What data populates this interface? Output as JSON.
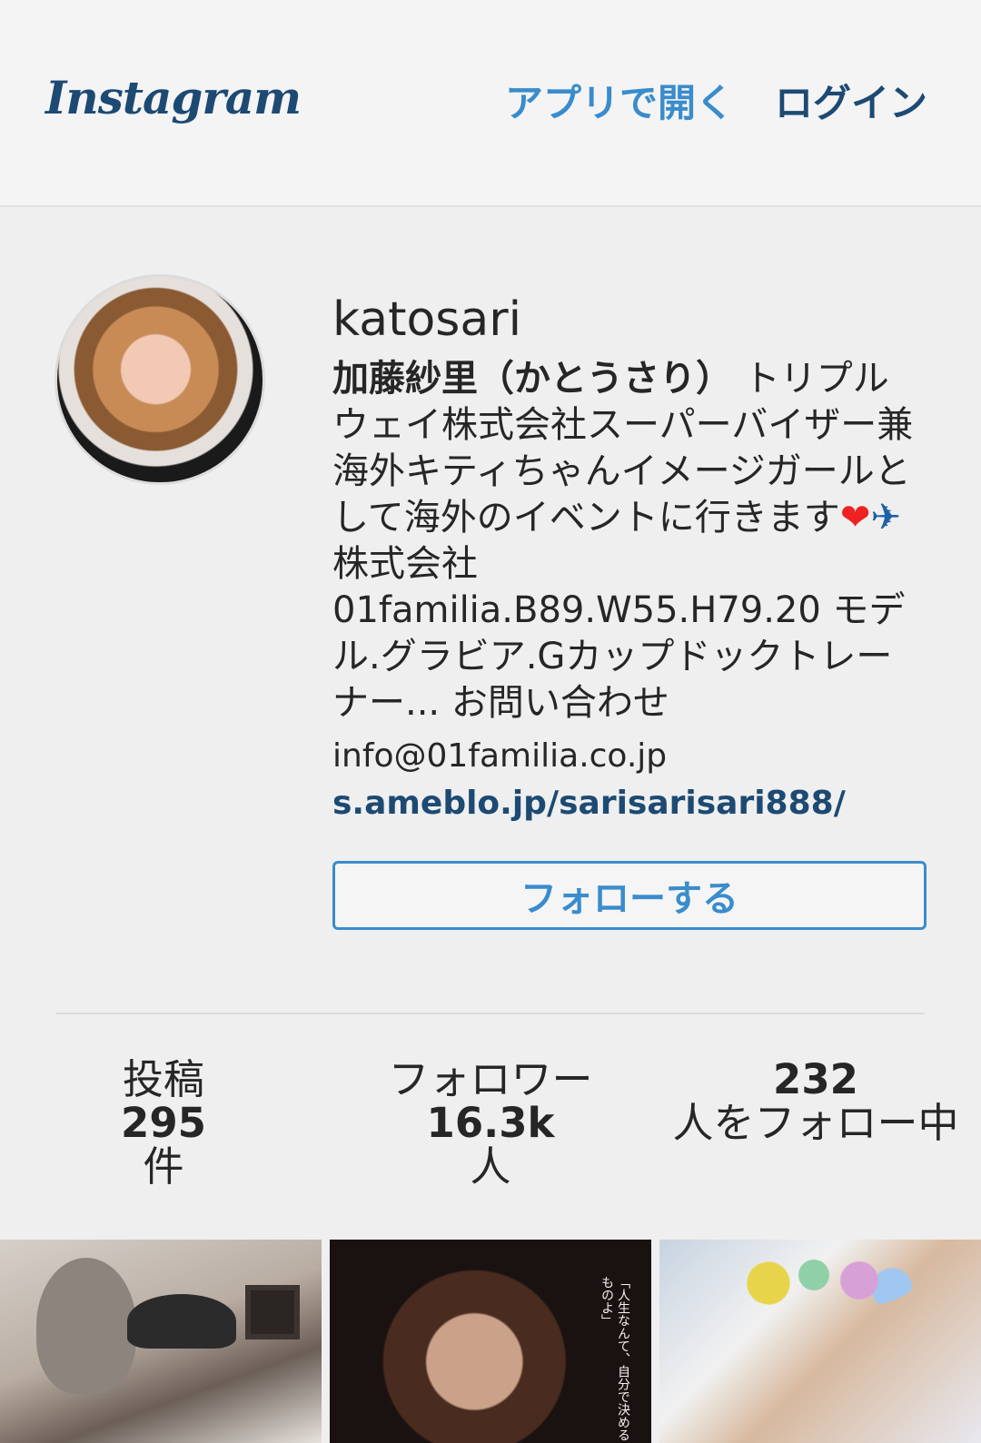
{
  "header": {
    "logo_text": "Instagram",
    "open_app_label": "アプリで開く",
    "login_label": "ログイン"
  },
  "profile": {
    "username": "katosari",
    "display_name": "加藤紗里（かとうさり）",
    "bio_part1": " トリプルウェイ株式会社スーパーバイザー兼海外キティちゃんイメージガールとして海外のイベントに行きます",
    "bio_heart": "❤",
    "bio_plane": "✈",
    "bio_part2": "株式会社01familia.B89.W55.H79.20 モデル.グラビア.Gカップドックトレーナー... お問い合わせ",
    "email": "info@01familia.co.jp",
    "website": "s.ameblo.jp/sarisarisari888/",
    "follow_button_label": "フォローする"
  },
  "stats": {
    "posts_label": "投稿",
    "posts_value": "295",
    "posts_unit": "件",
    "followers_label": "フォロワー",
    "followers_value": "16.3k",
    "followers_unit": "人",
    "following_value": "232",
    "following_label": "人をフォロー中"
  },
  "thumbnails": {
    "second_caption": "「人生なんて、自分で決めるものよ」"
  }
}
